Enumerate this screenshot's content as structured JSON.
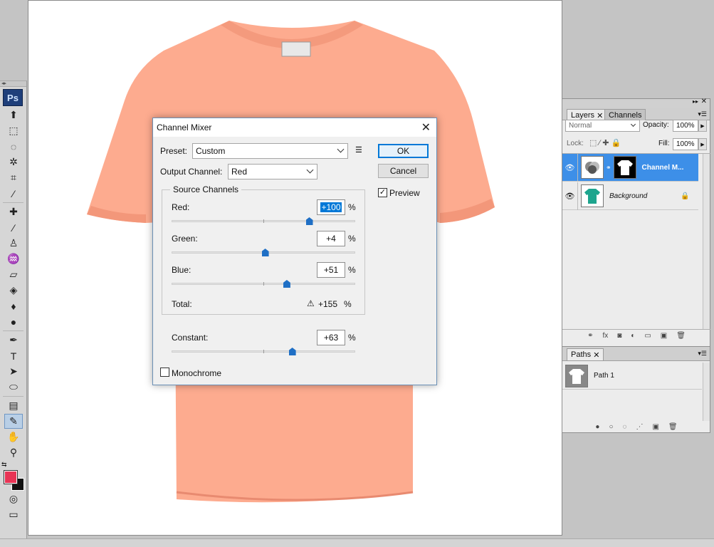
{
  "toolbox": {
    "grip": "◂▸",
    "logo": "Ps",
    "tools": [
      {
        "name": "move-tool",
        "glyph": "⬆"
      },
      {
        "name": "marquee-tool",
        "glyph": "⬚"
      },
      {
        "name": "lasso-tool",
        "glyph": "◌"
      },
      {
        "name": "magic-wand-tool",
        "glyph": "✲"
      },
      {
        "name": "crop-tool",
        "glyph": "⌗"
      },
      {
        "name": "eyedropper-tool",
        "glyph": "⁄"
      },
      {
        "name": "healing-brush-tool",
        "glyph": "✚"
      },
      {
        "name": "brush-tool",
        "glyph": "∕"
      },
      {
        "name": "clone-stamp-tool",
        "glyph": "♙"
      },
      {
        "name": "history-brush-tool",
        "glyph": "♒"
      },
      {
        "name": "eraser-tool",
        "glyph": "▱"
      },
      {
        "name": "paint-bucket-tool",
        "glyph": "◈"
      },
      {
        "name": "blur-tool",
        "glyph": "♦"
      },
      {
        "name": "dodge-tool",
        "glyph": "●"
      },
      {
        "name": "pen-tool",
        "glyph": "✒"
      },
      {
        "name": "type-tool",
        "glyph": "T"
      },
      {
        "name": "path-selection-tool",
        "glyph": "➤"
      },
      {
        "name": "ellipse-tool",
        "glyph": "⬭"
      },
      {
        "name": "notes-tool",
        "glyph": "▤"
      },
      {
        "name": "eyedropper-active-tool",
        "glyph": "✎",
        "active": true
      },
      {
        "name": "hand-tool",
        "glyph": "✋"
      },
      {
        "name": "zoom-tool",
        "glyph": "⚲"
      }
    ],
    "swap_glyph": "⇆",
    "fg_color": "#e83455",
    "bg_color": "#111111",
    "quickmask_glyph": "◎",
    "screenmode_glyph": "▭"
  },
  "dialog": {
    "title": "Channel Mixer",
    "close_glyph": "✕",
    "preset_label": "Preset:",
    "preset_value": "Custom",
    "preset_menu_glyph": "☰",
    "output_label": "Output Channel:",
    "output_value": "Red",
    "ok": "OK",
    "cancel": "Cancel",
    "preview_label": "Preview",
    "preview_checked": true,
    "source_group": "Source Channels",
    "channels": [
      {
        "label": "Red:",
        "value": "+100",
        "pct": "%",
        "selected": true,
        "level": 100
      },
      {
        "label": "Green:",
        "value": "+4",
        "pct": "%",
        "selected": false,
        "level": 4
      },
      {
        "label": "Blue:",
        "value": "+51",
        "pct": "%",
        "selected": false,
        "level": 51
      }
    ],
    "total_label": "Total:",
    "total_warn": "⚠",
    "total_value": "+155",
    "total_pct": "%",
    "constant_label": "Constant:",
    "constant_value": "+63",
    "constant_pct": "%",
    "constant_level": 63,
    "monochrome_label": "Monochrome",
    "monochrome_checked": false
  },
  "layers_panel": {
    "tab_layers": "Layers",
    "tab_channels": "Channels",
    "blend_mode": "Normal",
    "opacity_label": "Opacity:",
    "opacity_value": "100%",
    "lock_label": "Lock:",
    "fill_label": "Fill:",
    "fill_value": "100%",
    "layers": [
      {
        "name": "Channel M...",
        "selected": true
      },
      {
        "name": "Background",
        "selected": false
      }
    ],
    "footer": [
      "⚭",
      "fx",
      "◙",
      "◐",
      "▭",
      "▣",
      "🗑"
    ]
  },
  "paths_panel": {
    "tab_paths": "Paths",
    "paths": [
      {
        "name": "Path 1"
      }
    ],
    "footer": [
      "●",
      "○",
      "◌",
      "⋰",
      "▣",
      "🗑"
    ]
  },
  "colors": {
    "shirt": "#fdab8f",
    "accent": "#0078d7",
    "layer_sel": "#3d8fe8",
    "teal_shirt": "#1ea58e"
  }
}
